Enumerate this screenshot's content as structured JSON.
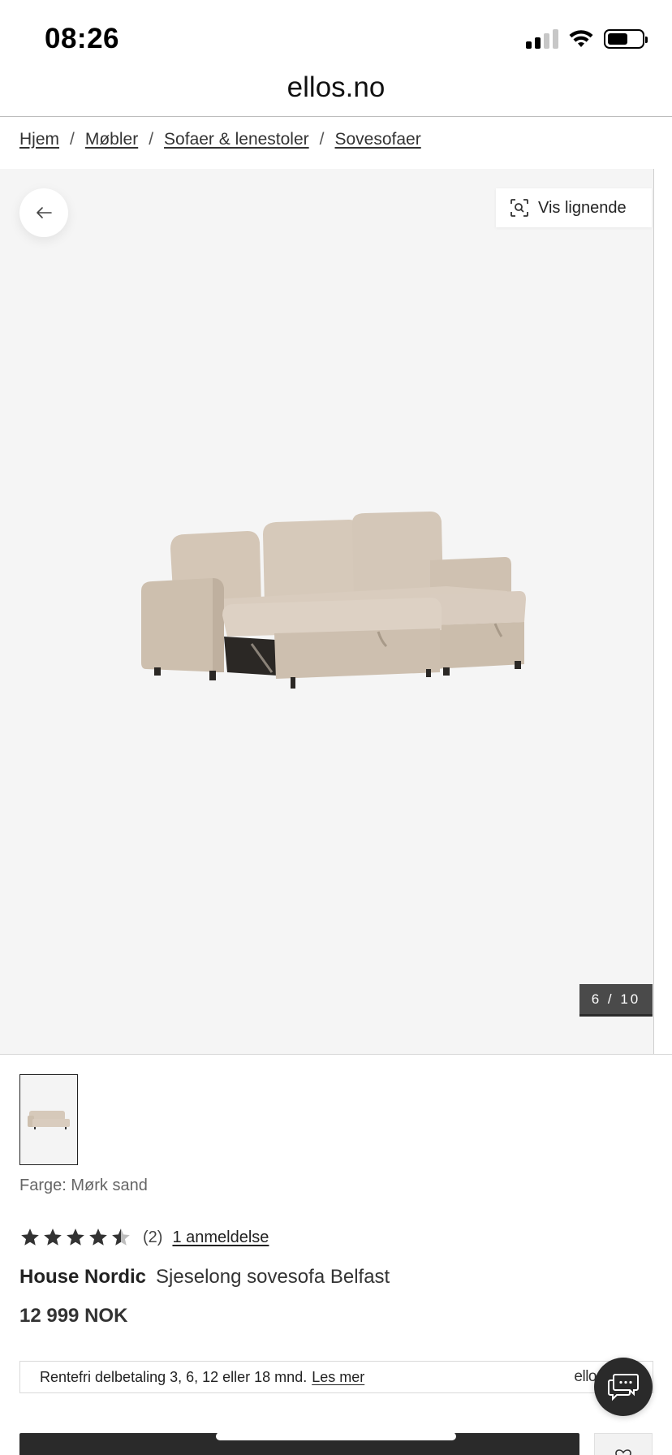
{
  "status_bar": {
    "time": "08:26"
  },
  "browser": {
    "url": "ellos.no"
  },
  "breadcrumb": [
    {
      "label": "Hjem"
    },
    {
      "label": "Møbler"
    },
    {
      "label": "Sofaer & lenestoler"
    },
    {
      "label": "Sovesofaer"
    }
  ],
  "breadcrumb_separator": "/",
  "gallery": {
    "similar_label": "Vis lignende",
    "counter": "6 / 10",
    "back_icon": "arrow-left-icon",
    "similar_icon": "visual-search-icon"
  },
  "product": {
    "color_label": "Farge: Mørk sand",
    "rating": 4.5,
    "rating_max": 5,
    "rating_count": "(2)",
    "review_link": "1 anmeldelse",
    "brand": "House Nordic",
    "name": "Sjeselong sovesofa Belfast",
    "price": "12 999 NOK"
  },
  "finance": {
    "text": "Rentefri delbetaling 3, 6, 12 eller 18 mnd.",
    "link": "Les mer",
    "logo": "ellos"
  },
  "colors": {
    "gallery_bg": "#f5f5f5",
    "dark_button": "#2a2a2a",
    "sofa": "#d8cbbd"
  }
}
